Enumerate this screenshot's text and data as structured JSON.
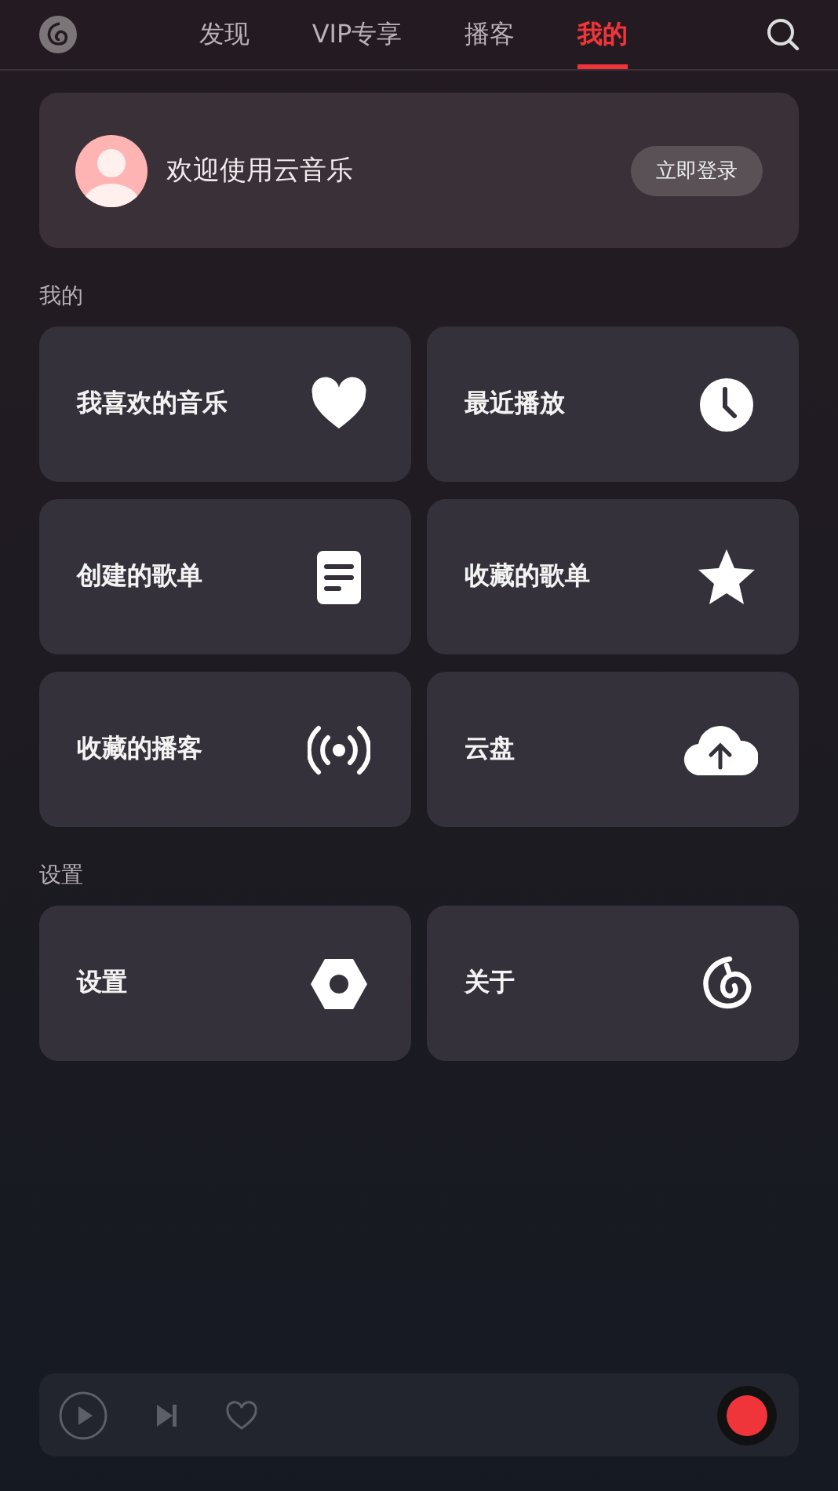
{
  "nav": {
    "tabs": [
      {
        "label": "发现",
        "selected": false
      },
      {
        "label": "VIP专享",
        "selected": false
      },
      {
        "label": "播客",
        "selected": false
      },
      {
        "label": "我的",
        "selected": true
      }
    ]
  },
  "profile": {
    "greeting": "欢迎使用云音乐",
    "login_button": "立即登录"
  },
  "sections": [
    {
      "title": "我的",
      "tiles": [
        {
          "label": "我喜欢的音乐",
          "kind": "heart"
        },
        {
          "label": "最近播放",
          "kind": "clock"
        },
        {
          "label": "创建的歌单",
          "kind": "document"
        },
        {
          "label": "收藏的歌单",
          "kind": "star"
        },
        {
          "label": "收藏的播客",
          "kind": "broadcast"
        },
        {
          "label": "云盘",
          "kind": "cloud"
        }
      ]
    },
    {
      "title": "设置",
      "tiles": [
        {
          "label": "设置",
          "kind": "hexagon"
        },
        {
          "label": "关于",
          "kind": "logo"
        }
      ]
    }
  ],
  "player": {
    "liked": false
  }
}
